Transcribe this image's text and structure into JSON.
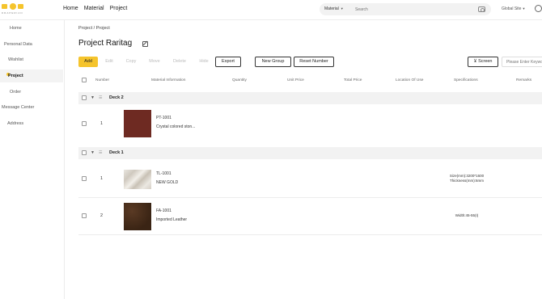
{
  "brand": {
    "wordmark": "DRAPERIAN"
  },
  "nav": [
    "Home",
    "Material",
    "Project"
  ],
  "search": {
    "category": "Material",
    "placeholder": "Search"
  },
  "global_site": "Global Site",
  "sidebar": [
    "Home",
    "Personal Data",
    "Wishlist",
    "Project",
    "Order",
    "Message Center",
    "Address"
  ],
  "breadcrumb": "Project / Project",
  "page_title": "Project Raritag",
  "toolbar": {
    "add": "Add",
    "edit": "Edit",
    "copy": "Copy",
    "move": "Move",
    "delete": "Delete",
    "hide": "Hide",
    "export": "Export",
    "new_group": "New Group",
    "reset_number": "Reset Number",
    "screen": "Screen",
    "filter_placeholder": "Please Enter Keyword"
  },
  "columns": [
    "Number",
    "Material Information",
    "Quantity",
    "Unit Price",
    "Total Price",
    "Location Of Use",
    "Specifications",
    "Remarks"
  ],
  "groups": [
    {
      "name": "Deck 2",
      "rows": [
        {
          "number": "1",
          "code": "PT-1001",
          "name": "Crystal colored ston...",
          "spec": "",
          "thumb": "brown"
        }
      ]
    },
    {
      "name": "Deck 1",
      "rows": [
        {
          "number": "1",
          "code": "TL-1001",
          "name": "NEW GOLD",
          "spec": "Size(mm):3200*1600 Thickness(mm):6mm",
          "thumb": "marble"
        },
        {
          "number": "2",
          "code": "FA-1001",
          "name": "Imported Leather",
          "spec": "Width:45-55(I)",
          "thumb": "leather"
        }
      ]
    }
  ],
  "colors": {
    "accent": "#f5c42c",
    "group_bg": "#f2f2f2",
    "sidebar_active": "#f3f3f3"
  }
}
